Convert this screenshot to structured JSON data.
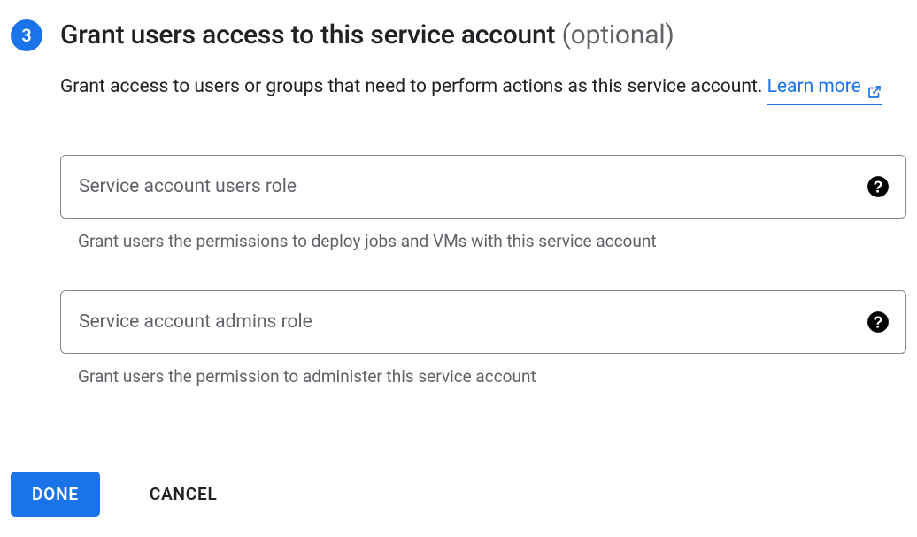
{
  "step": {
    "number": "3",
    "title": "Grant users access to this service account",
    "optional_label": "(optional)"
  },
  "description": {
    "text": "Grant access to users or groups that need to perform actions as this service account.",
    "learn_more_label": "Learn more"
  },
  "fields": {
    "users_role": {
      "placeholder": "Service account users role",
      "hint": "Grant users the permissions to deploy jobs and VMs with this service account"
    },
    "admins_role": {
      "placeholder": "Service account admins role",
      "hint": "Grant users the permission to administer this service account"
    }
  },
  "buttons": {
    "done": "DONE",
    "cancel": "CANCEL"
  }
}
